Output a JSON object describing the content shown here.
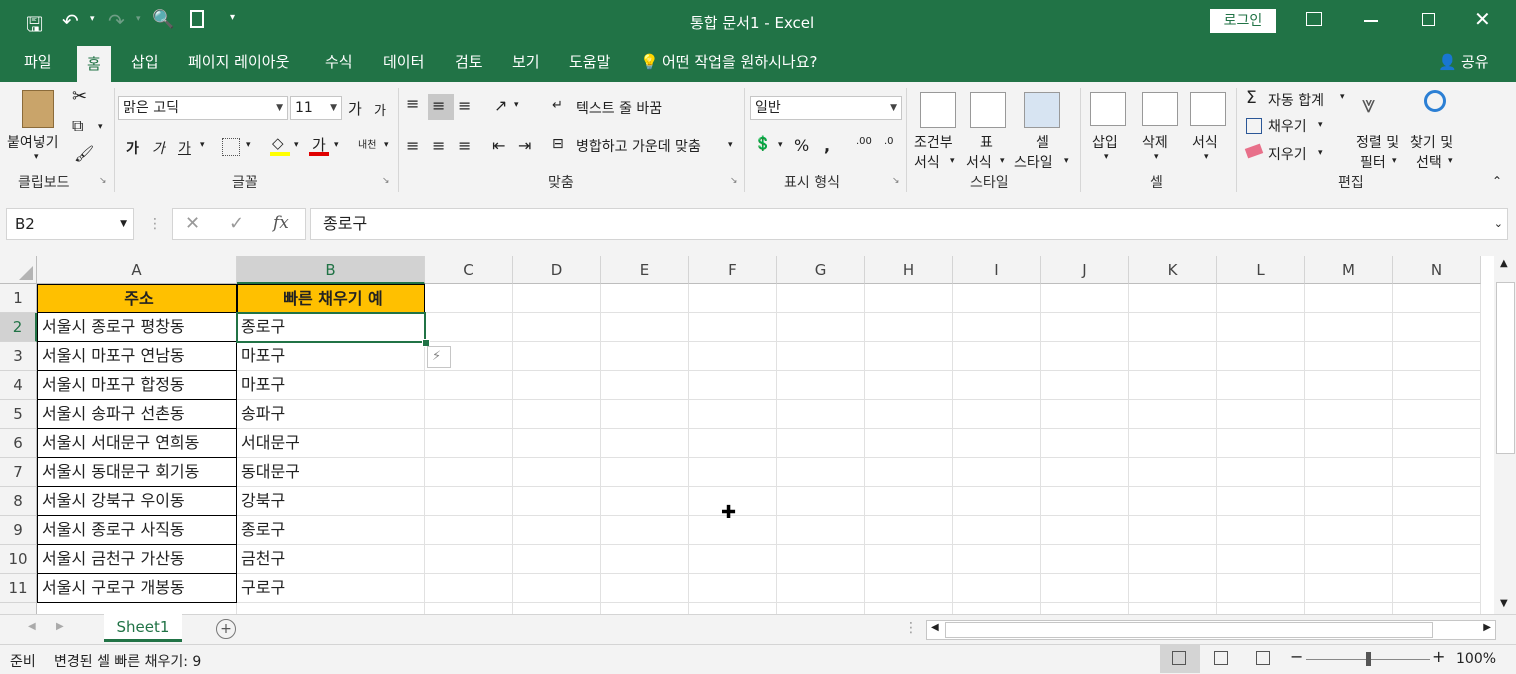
{
  "titlebar": {
    "title": "통합 문서1  -  Excel",
    "login": "로그인"
  },
  "menu": {
    "tabs": [
      "파일",
      "홈",
      "삽입",
      "페이지 레이아웃",
      "수식",
      "데이터",
      "검토",
      "보기",
      "도움말"
    ],
    "tell_me": "어떤 작업을 원하시나요?",
    "share": "공유"
  },
  "ribbon": {
    "clipboard": {
      "paste": "붙여넣기",
      "label": "클립보드"
    },
    "font": {
      "name": "맑은 고딕",
      "size": "11",
      "label": "글꼴",
      "bold": "가",
      "italic": "가",
      "underline": "가",
      "grow": "가",
      "shrink": "가",
      "color_a": "가",
      "phonetic": "내천"
    },
    "alignment": {
      "wrap": "텍스트 줄 바꿈",
      "merge": "병합하고 가운데 맞춤",
      "label": "맞춤"
    },
    "number": {
      "format": "일반",
      "label": "표시 형식"
    },
    "styles": {
      "cond1": "조건부",
      "cond2": "서식",
      "table1": "표",
      "table2": "서식",
      "cell1": "셀",
      "cell2": "스타일",
      "label": "스타일"
    },
    "cells": {
      "insert": "삽입",
      "delete": "삭제",
      "format": "서식",
      "label": "셀"
    },
    "editing": {
      "autosum": "자동 합계",
      "fill": "채우기",
      "clear": "지우기",
      "sort1": "정렬 및",
      "sort2": "필터",
      "find1": "찾기 및",
      "find2": "선택",
      "label": "편집"
    }
  },
  "formula_bar": {
    "name_box": "B2",
    "formula": "종로구"
  },
  "sheet": {
    "columns": [
      "A",
      "B",
      "C",
      "D",
      "E",
      "F",
      "G",
      "H",
      "I",
      "J",
      "K",
      "L",
      "M",
      "N"
    ],
    "rows": [
      "1",
      "2",
      "3",
      "4",
      "5",
      "6",
      "7",
      "8",
      "9",
      "10",
      "11"
    ],
    "header_a": "주소",
    "header_b": "빠른 채우기 예",
    "col_a": [
      "서울시 종로구 평창동",
      "서울시 마포구 연남동",
      "서울시 마포구 합정동",
      "서울시 송파구 선촌동",
      "서울시 서대문구 연희동",
      "서울시 동대문구 회기동",
      "서울시 강북구 우이동",
      "서울시 종로구 사직동",
      "서울시 금천구 가산동",
      "서울시 구로구 개봉동"
    ],
    "col_b": [
      "종로구",
      "마포구",
      "마포구",
      "송파구",
      "서대문구",
      "동대문구",
      "강북구",
      "종로구",
      "금천구",
      "구로구"
    ],
    "header_fill": "#FFC000",
    "accent": "#217346"
  },
  "tabs": {
    "sheet1": "Sheet1"
  },
  "status": {
    "ready": "준비",
    "message": "변경된 셀 빠른 채우기: 9",
    "zoom": "100%",
    "zoom_level": 100
  }
}
